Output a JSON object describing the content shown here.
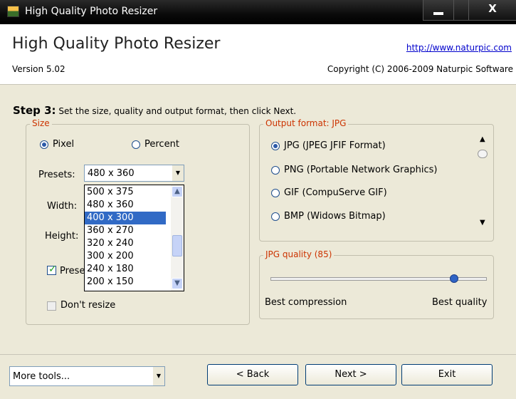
{
  "window": {
    "title": "High Quality Photo Resizer",
    "close_glyph": "X"
  },
  "header": {
    "app_title": "High Quality Photo Resizer",
    "website": "http://www.naturpic.com",
    "version": "Version 5.02",
    "copyright": "Copyright (C) 2006-2009 Naturpic Software"
  },
  "step": {
    "label": "Step 3:",
    "text": "Set the size, quality and output format, then click Next."
  },
  "size_group": {
    "legend": "Size",
    "pixel_label": "Pixel",
    "percent_label": "Percent",
    "presets_label": "Presets:",
    "presets_value": "480 x 360",
    "width_label": "Width:",
    "height_label": "Height:",
    "preserve_label": "Prese",
    "dont_resize_label": "Don't resize",
    "preset_options": [
      "500 x 375",
      "480 x 360",
      "400 x 300",
      "360 x 270",
      "320 x 240",
      "300 x 200",
      "240 x 180",
      "200 x 150"
    ],
    "selected_option": "400 x 300"
  },
  "output_group": {
    "legend": "Output format: JPG",
    "formats": [
      "JPG (JPEG JFIF Format)",
      "PNG (Portable Network Graphics)",
      "GIF (CompuServe GIF)",
      "BMP (Widows Bitmap)"
    ],
    "selected_format": "JPG (JPEG JFIF Format)"
  },
  "quality_group": {
    "legend": "JPG quality (85)",
    "value": 85,
    "min_label": "Best compression",
    "max_label": "Best quality"
  },
  "footer": {
    "more_tools": "More tools...",
    "back": "< Back",
    "next": "Next >",
    "exit": "Exit"
  },
  "icons": [
    "app-icon",
    "minimize-icon",
    "maximize-icon",
    "close-icon",
    "chevron-down-icon",
    "scroll-up-icon",
    "scroll-down-icon",
    "checkmark-icon"
  ]
}
